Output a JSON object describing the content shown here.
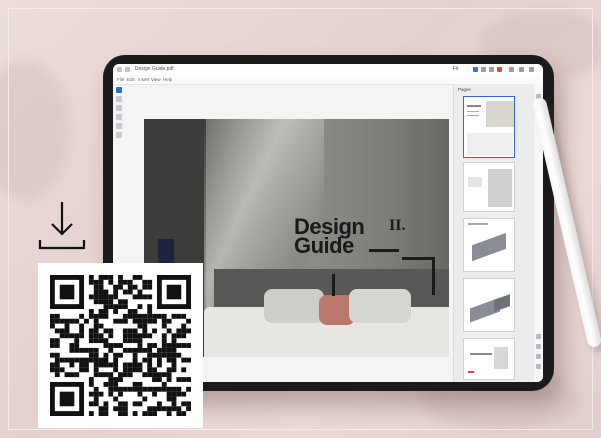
{
  "app": {
    "window_title": "Design Guide.pdf",
    "menu": [
      "File",
      "Edit",
      "Insert",
      "View",
      "Help"
    ],
    "zoom": "Fit"
  },
  "page_content": {
    "title_line1": "Design",
    "title_line2": "Guide",
    "roman": "II."
  },
  "panel": {
    "title": "Pages",
    "page_count": 5,
    "selected_page": 1
  },
  "colors": {
    "accent": "#2b6fd6",
    "background": "#e9d8d6",
    "tablet_bezel": "#1b1b1d"
  },
  "icons": {
    "download": "download-icon",
    "qr": "qr-code"
  }
}
